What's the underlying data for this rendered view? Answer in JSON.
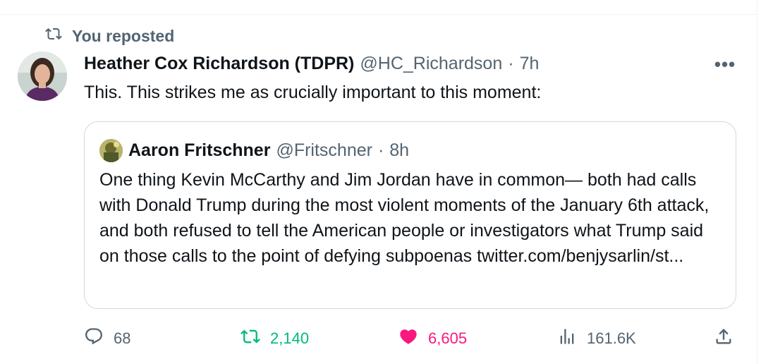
{
  "repost": {
    "label": "You reposted",
    "icon": "repost-icon"
  },
  "tweet": {
    "author": {
      "name": "Heather Cox Richardson (TDPR)",
      "handle": "@HC_Richardson",
      "age": "7h"
    },
    "text": "This. This strikes me as crucially important to this moment:",
    "more_icon": "more-options-icon"
  },
  "quote": {
    "author": {
      "name": "Aaron Fritschner",
      "handle": "@Fritschner",
      "age": "8h"
    },
    "text": "One thing Kevin McCarthy and Jim Jordan have in common— both had calls with Donald Trump during the most violent moments of the January 6th attack, and both refused to tell the American people or investigators what Trump said on those calls to the point of defying subpoenas twitter.com/benjysarlin/st..."
  },
  "actions": {
    "replies": "68",
    "reposts": "2,140",
    "likes": "6,605",
    "views": "161.6K"
  },
  "colors": {
    "text": "#0f1419",
    "secondary": "#536471",
    "repost_active": "#00ba7c",
    "like_active": "#f91880",
    "border": "#cfd9de"
  },
  "separator": "·"
}
